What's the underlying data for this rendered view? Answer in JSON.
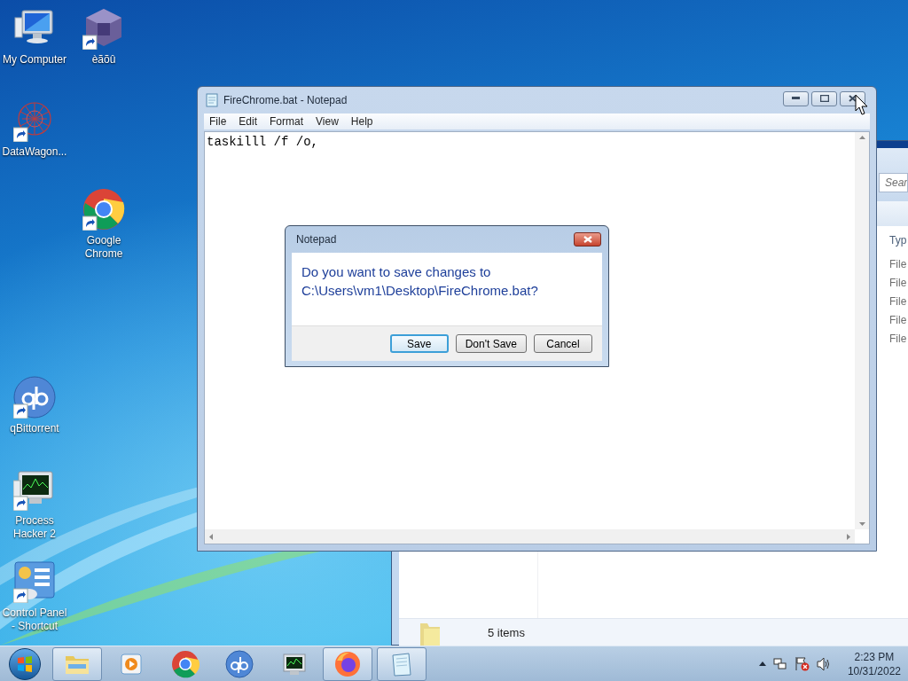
{
  "desktop_icons": [
    {
      "label": "My Computer",
      "kind": "computer",
      "shortcut": false
    },
    {
      "label": "èãõû",
      "kind": "cube",
      "shortcut": true
    },
    {
      "label": "DataWagon...",
      "kind": "web",
      "shortcut": true
    },
    {
      "label": "Google Chrome",
      "kind": "chrome",
      "shortcut": true
    },
    {
      "label": "qBittorrent",
      "kind": "qb",
      "shortcut": true
    },
    {
      "label": "Process Hacker 2",
      "kind": "monitor",
      "shortcut": true
    },
    {
      "label": "Control Panel - Shortcut",
      "kind": "panel",
      "shortcut": true
    }
  ],
  "explorer": {
    "search_placeholder": "Sear",
    "column_header": "Typ",
    "rows": [
      "File",
      "File",
      "File",
      "File",
      "File"
    ],
    "status": "5 items"
  },
  "notepad": {
    "title": "FireChrome.bat - Notepad",
    "menu": [
      "File",
      "Edit",
      "Format",
      "View",
      "Help"
    ],
    "text": "taskilll /f /o,"
  },
  "dialog": {
    "title": "Notepad",
    "message": "Do you want to save changes to C:\\Users\\vm1\\Desktop\\FireChrome.bat?",
    "buttons": [
      {
        "label": "Save",
        "selected": true
      },
      {
        "label": "Don't Save",
        "selected": false
      },
      {
        "label": "Cancel",
        "selected": false
      }
    ]
  },
  "taskbar": {
    "items": [
      {
        "kind": "explorer",
        "open": true
      },
      {
        "kind": "media",
        "open": false
      },
      {
        "kind": "chrome",
        "open": false
      },
      {
        "kind": "qb",
        "open": false
      },
      {
        "kind": "monitor",
        "open": false
      },
      {
        "kind": "firefox",
        "open": true
      },
      {
        "kind": "notepad",
        "open": true
      }
    ],
    "clock": {
      "time": "2:23 PM",
      "date": "10/31/2022"
    }
  }
}
